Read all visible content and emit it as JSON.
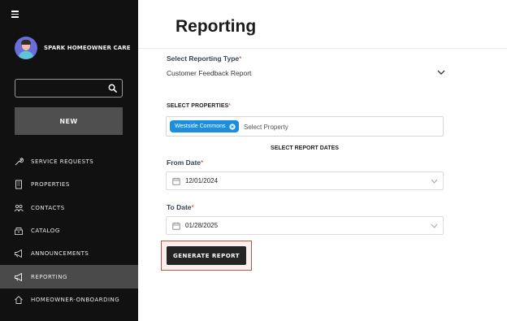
{
  "sidebar": {
    "company_name": "SPARK HOMEOWNER CARE",
    "search": {
      "value": "",
      "placeholder": ""
    },
    "new_button": "NEW",
    "items": [
      {
        "label": "SERVICE REQUESTS",
        "icon": "wrench-icon"
      },
      {
        "label": "PROPERTIES",
        "icon": "building-icon"
      },
      {
        "label": "CONTACTS",
        "icon": "people-icon"
      },
      {
        "label": "CATALOG",
        "icon": "catalog-icon"
      },
      {
        "label": "ANNOUNCEMENTS",
        "icon": "megaphone-icon"
      },
      {
        "label": "REPORTING",
        "icon": "megaphone-icon",
        "active": true
      },
      {
        "label": "HOMEOWNER-ONBOARDING",
        "icon": "home-icon"
      }
    ]
  },
  "main": {
    "title": "Reporting",
    "report_type": {
      "label": "Select Reporting Type",
      "required": "*",
      "value": "Customer Feedback Report"
    },
    "properties": {
      "label": "SELECT PROPERTIES",
      "required": "*",
      "chips": [
        "Westside Commons"
      ],
      "placeholder": "Select Property"
    },
    "dates_heading": "SELECT REPORT DATES",
    "from_date": {
      "label": "From Date",
      "required": "*",
      "value": "12/01/2024"
    },
    "to_date": {
      "label": "To Date",
      "required": "*",
      "value": "01/28/2025"
    },
    "generate_button": "GENERATE REPORT"
  },
  "colors": {
    "sidebar_bg": "#111111",
    "active_item": "#4a4a4a",
    "chip": "#1b8ee0",
    "required": "#d8343a",
    "primary_button": "#242424"
  }
}
